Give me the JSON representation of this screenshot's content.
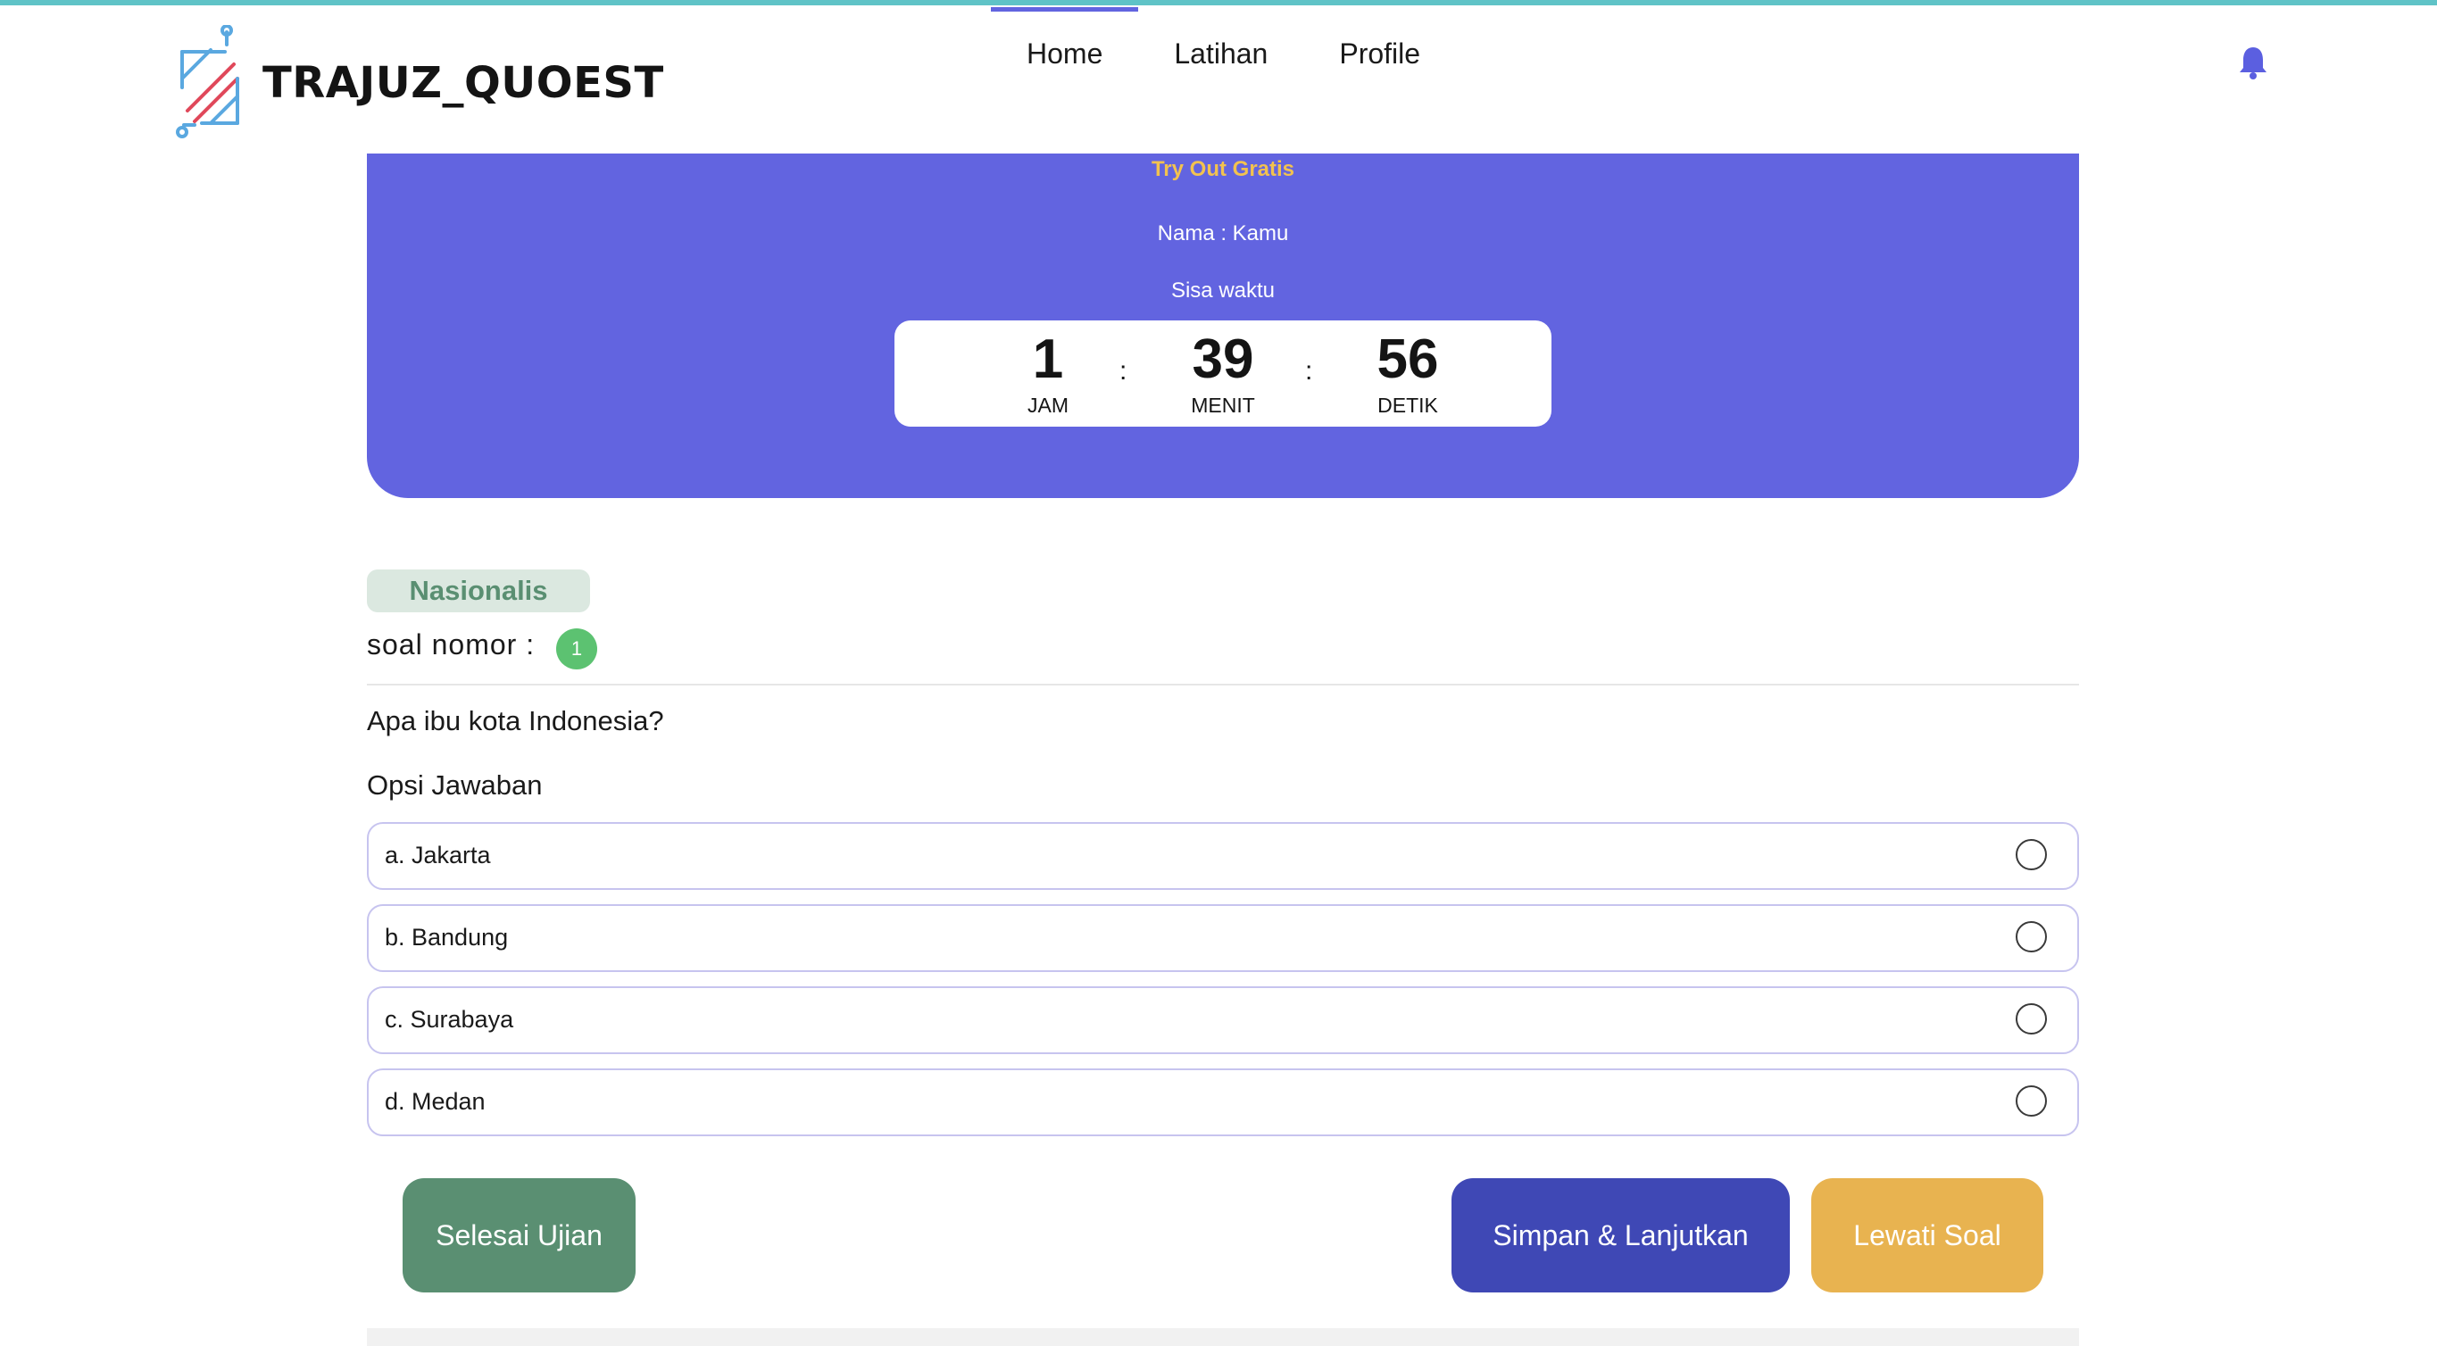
{
  "brand": {
    "name": "TRAJUZ_QUOEST"
  },
  "nav": {
    "items": [
      "Home",
      "Latihan",
      "Profile"
    ],
    "active": "Home"
  },
  "panel": {
    "title": "Try Out Gratis",
    "name_line": "Nama : Kamu",
    "sisa_label": "Sisa waktu",
    "timer": {
      "hours": "1",
      "hours_label": "JAM",
      "minutes": "39",
      "minutes_label": "MENIT",
      "seconds": "56",
      "seconds_label": "DETIK",
      "separator": ":"
    }
  },
  "question": {
    "category": "Nasionalis",
    "number_label": "soal nomor :",
    "number": "1",
    "text": "Apa ibu kota Indonesia?",
    "options_label": "Opsi Jawaban",
    "options": [
      "a. Jakarta",
      "b. Bandung",
      "c. Surabaya",
      "d. Medan"
    ]
  },
  "buttons": {
    "finish": "Selesai Ujian",
    "save_next": "Simpan & Lanjutkan",
    "skip": "Lewati Soal"
  },
  "colors": {
    "accent": "#6264e0",
    "panel_title": "#f2c24f",
    "finish": "#5a8f72",
    "save": "#3f48b5",
    "skip": "#e8b350",
    "badge": "#5cc271"
  },
  "icons": {
    "logo": "trajuz-logo-icon",
    "notification": "bell-icon",
    "option_radio": "radio-icon"
  }
}
